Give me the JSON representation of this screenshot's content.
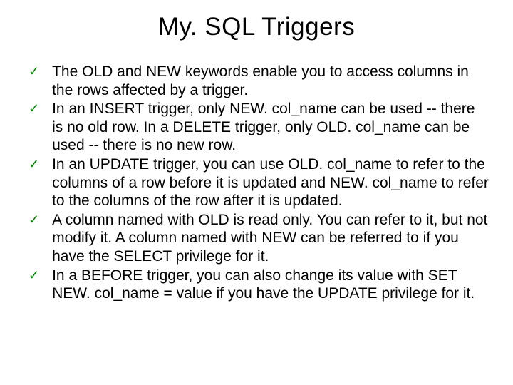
{
  "slide": {
    "title": "My. SQL Triggers",
    "bullets": [
      "The OLD and NEW keywords enable you to access columns in the rows affected by a trigger.",
      "In an INSERT trigger, only NEW. col_name can be used -- there is no old row. In a DELETE trigger, only OLD. col_name can be used -- there is no new row.",
      "In an UPDATE trigger, you can use OLD. col_name to refer to the columns of a row before it is updated and NEW. col_name to refer to the columns of the row after it is updated.",
      "A column named with OLD is read only. You can refer to it, but not modify it. A column named with NEW can be referred to if you have the SELECT privilege for it.",
      "In a BEFORE trigger, you can also change its value with SET NEW. col_name = value if you have the UPDATE privilege for it."
    ]
  }
}
